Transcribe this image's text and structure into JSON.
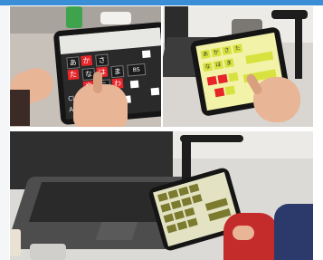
{
  "colors": {
    "accent": "#3a8ed6",
    "key_red": "#e8262a",
    "key_dark": "#1b1b1b",
    "key_olive": "#7b7a2f",
    "key_yellow": "#d8e23e",
    "screen_dark": "#2a2a2a",
    "screen_light": "#e7e8e3",
    "screen_yellow": "#f2f2a9"
  },
  "panels": [
    {
      "name": "user-tapping-dark-keyboard-photo",
      "keys": [
        "あ",
        "か",
        "さ",
        "た",
        "な",
        "は",
        "ま",
        "や",
        "ら",
        "わ",
        "BS",
        "Clr",
        "Alpha"
      ]
    },
    {
      "name": "user-tapping-yellow-keyboard-photo",
      "keys": [
        "あ",
        "か",
        "さ",
        "た",
        "な",
        "は",
        "ま"
      ]
    },
    {
      "name": "tablet-next-to-laptop-photo",
      "keys": []
    }
  ]
}
